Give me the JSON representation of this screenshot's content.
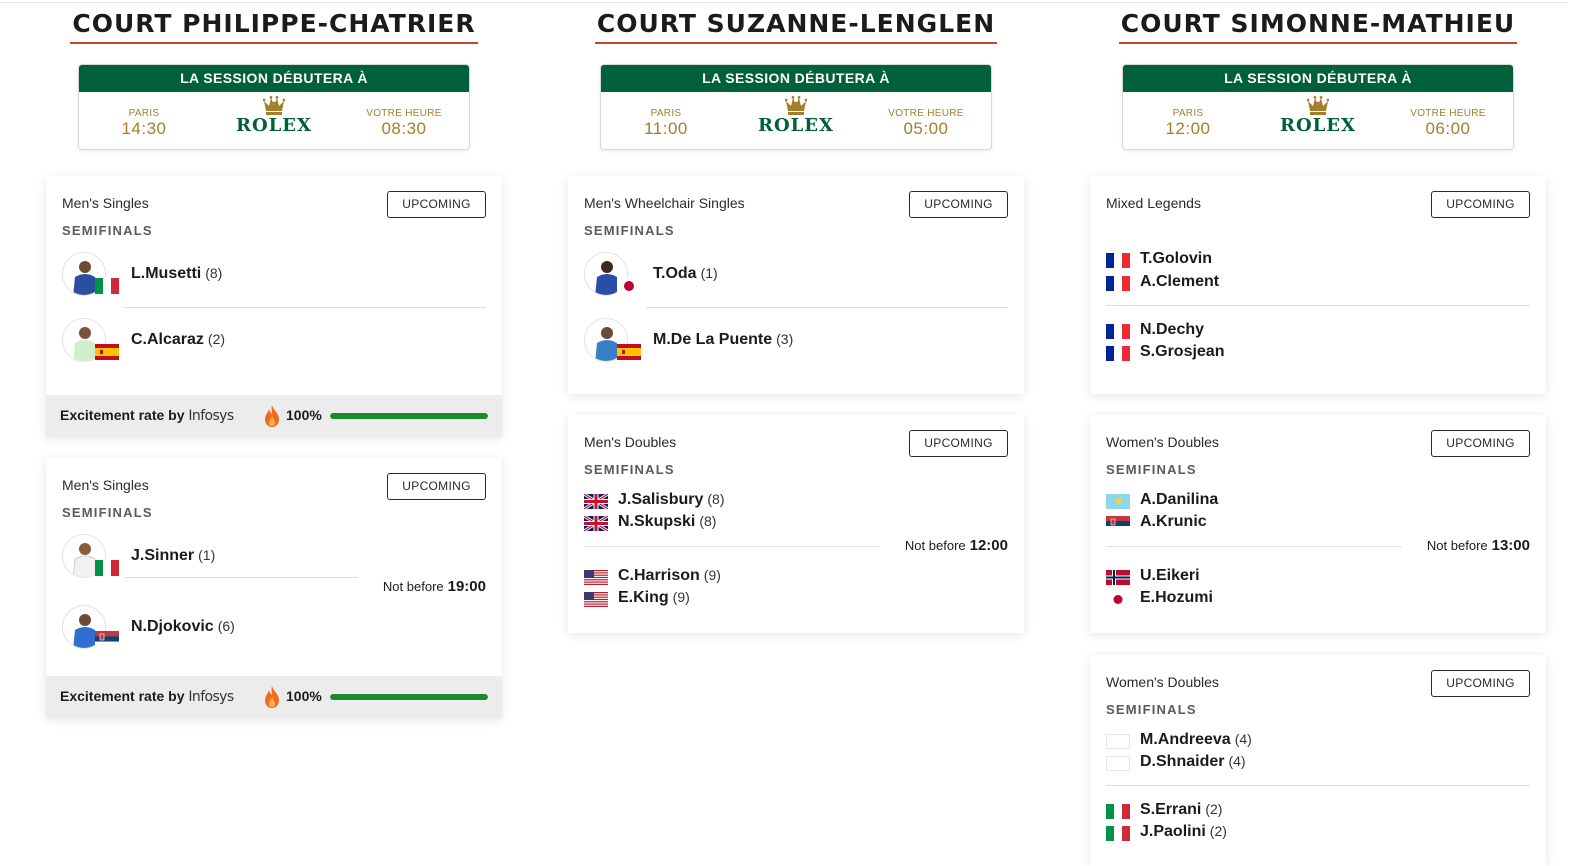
{
  "session_header": "LA SESSION DÉBUTERA À",
  "brand": "ROLEX",
  "status_label": "UPCOMING",
  "not_before_label": "Not before",
  "excitement": {
    "label": "Excitement rate by",
    "sponsor": "Infosys"
  },
  "colors": {
    "accent_green": "#006039",
    "gold": "#a37e2c",
    "title_underline": "#c8472a",
    "progress_green": "#1a8a2a"
  },
  "icons": [
    "rolex-crown-icon",
    "flame-icon",
    "player-photo-icon",
    "country-flag-icon"
  ],
  "courts": [
    {
      "name": "COURT PHILIPPE-CHATRIER",
      "local_label": "PARIS",
      "local_time": "14:30",
      "yours_label": "VOTRE HEURE",
      "yours_time": "08:30",
      "matches": [
        {
          "event": "Men's Singles",
          "round": "SEMIFINALS",
          "players": [
            {
              "name": "L.Musetti",
              "seed": "(8)",
              "flag": "ITA"
            },
            {
              "name": "C.Alcaraz",
              "seed": "(2)",
              "flag": "ESP"
            }
          ],
          "excitement_rate": "100%",
          "excitement_fraction": 1.0
        },
        {
          "event": "Men's Singles",
          "round": "SEMIFINALS",
          "players": [
            {
              "name": "J.Sinner",
              "seed": "(1)",
              "flag": "ITA"
            },
            {
              "name": "N.Djokovic",
              "seed": "(6)",
              "flag": "SRB"
            }
          ],
          "not_before": "19:00",
          "excitement_rate": "100%",
          "excitement_fraction": 1.0
        }
      ]
    },
    {
      "name": "COURT SUZANNE-LENGLEN",
      "local_label": "PARIS",
      "local_time": "11:00",
      "yours_label": "VOTRE HEURE",
      "yours_time": "05:00",
      "matches": [
        {
          "event": "Men's Wheelchair Singles",
          "round": "SEMIFINALS",
          "players": [
            {
              "name": "T.Oda",
              "seed": "(1)",
              "flag": "JPN"
            },
            {
              "name": "M.De La Puente",
              "seed": "(3)",
              "flag": "ESP"
            }
          ]
        },
        {
          "event": "Men's Doubles",
          "round": "SEMIFINALS",
          "teams": [
            [
              {
                "name": "J.Salisbury",
                "seed": "(8)",
                "flag": "GBR"
              },
              {
                "name": "N.Skupski",
                "seed": "(8)",
                "flag": "GBR"
              }
            ],
            [
              {
                "name": "C.Harrison",
                "seed": "(9)",
                "flag": "USA"
              },
              {
                "name": "E.King",
                "seed": "(9)",
                "flag": "USA"
              }
            ]
          ],
          "not_before": "12:00"
        }
      ]
    },
    {
      "name": "COURT SIMONNE-MATHIEU",
      "local_label": "PARIS",
      "local_time": "12:00",
      "yours_label": "VOTRE HEURE",
      "yours_time": "06:00",
      "matches": [
        {
          "event": "Mixed Legends",
          "teams": [
            [
              {
                "name": "T.Golovin",
                "seed": "",
                "flag": "FRA"
              },
              {
                "name": "A.Clement",
                "seed": "",
                "flag": "FRA"
              }
            ],
            [
              {
                "name": "N.Dechy",
                "seed": "",
                "flag": "FRA"
              },
              {
                "name": "S.Grosjean",
                "seed": "",
                "flag": "FRA"
              }
            ]
          ]
        },
        {
          "event": "Women's Doubles",
          "round": "SEMIFINALS",
          "teams": [
            [
              {
                "name": "A.Danilina",
                "seed": "",
                "flag": "KAZ"
              },
              {
                "name": "A.Krunic",
                "seed": "",
                "flag": "SRB"
              }
            ],
            [
              {
                "name": "U.Eikeri",
                "seed": "",
                "flag": "NOR"
              },
              {
                "name": "E.Hozumi",
                "seed": "",
                "flag": "JPN"
              }
            ]
          ],
          "not_before": "13:00"
        },
        {
          "event": "Women's Doubles",
          "round": "SEMIFINALS",
          "teams": [
            [
              {
                "name": "M.Andreeva",
                "seed": "(4)",
                "flag": "NEUTRAL"
              },
              {
                "name": "D.Shnaider",
                "seed": "(4)",
                "flag": "NEUTRAL"
              }
            ],
            [
              {
                "name": "S.Errani",
                "seed": "(2)",
                "flag": "ITA"
              },
              {
                "name": "J.Paolini",
                "seed": "(2)",
                "flag": "ITA"
              }
            ]
          ]
        }
      ]
    }
  ]
}
